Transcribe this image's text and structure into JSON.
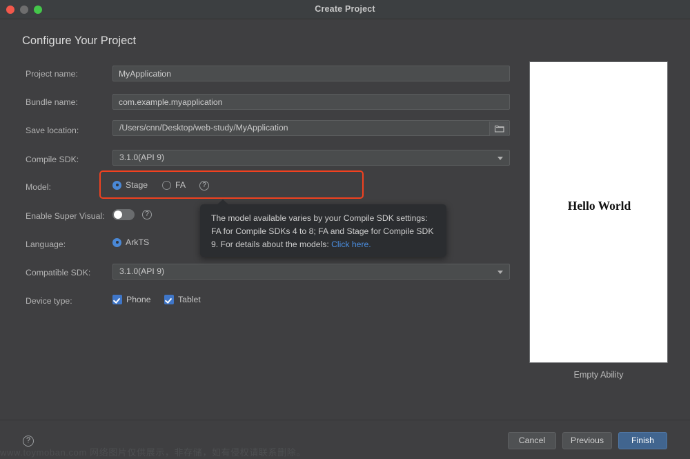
{
  "window": {
    "title": "Create Project",
    "traffic_lights": [
      "close-button",
      "minimize-button",
      "maximize-button"
    ]
  },
  "page_title": "Configure Your Project",
  "form": {
    "project_name": {
      "label": "Project name:",
      "value": "MyApplication",
      "placeholder": "Project name"
    },
    "bundle_name": {
      "label": "Bundle name:",
      "value": "com.example.myapplication",
      "placeholder": "Bundle name"
    },
    "save_location": {
      "label": "Save location:",
      "value": "/Users/cnn/Desktop/web-study/MyApplication",
      "placeholder": "Save location",
      "browse_icon": "folder-icon"
    },
    "compile_sdk": {
      "label": "Compile SDK:",
      "value": "3.1.0(API 9)",
      "options": [
        "3.1.0(API 9)"
      ],
      "arrow_icon": "chevron-down-icon"
    },
    "model": {
      "label": "Model:",
      "options": [
        {
          "label": "Stage",
          "selected": true
        },
        {
          "label": "FA",
          "selected": false
        }
      ],
      "help_icon": "question-mark-icon",
      "help_glyph": "?"
    },
    "enable_super_visual": {
      "label": "Enable Super Visual:",
      "state": "off",
      "help_icon": "question-mark-icon",
      "help_glyph": "?"
    },
    "language": {
      "label": "Language:",
      "options": [
        {
          "label": "ArkTS",
          "selected": true
        }
      ]
    },
    "compatible_sdk": {
      "label": "Compatible SDK:",
      "value": "3.1.0(API 9)",
      "options": [
        "3.1.0(API 9)"
      ],
      "arrow_icon": "chevron-down-icon"
    },
    "device_type": {
      "label": "Device type:",
      "options": [
        {
          "label": "Phone",
          "checked": true
        },
        {
          "label": "Tablet",
          "checked": true
        }
      ]
    }
  },
  "tooltip": {
    "line1": "The model available varies by your Compile SDK settings:",
    "line2": "FA for Compile SDKs 4 to 8; FA and Stage for Compile SDK",
    "line3_prefix": "9. For details about the models: ",
    "link_text": "Click here."
  },
  "preview": {
    "text": "Hello World",
    "caption": "Empty Ability"
  },
  "footer": {
    "help_icon": "question-mark-icon",
    "help_glyph": "?",
    "cancel": "Cancel",
    "previous": "Previous",
    "finish": "Finish"
  },
  "watermark": "www.toymoban.com 网络图片仅供展示，非存储，如有侵权请联系删除。",
  "colors": {
    "dialog_bg": "#3f3f41",
    "titlebar_bg": "#3c3f41",
    "field_bg": "#4b4d4e",
    "accent_blue": "#4a88d6",
    "primary_button": "#41658f",
    "highlight_red": "#f2411f",
    "tooltip_bg": "#2b2d30",
    "link_blue": "#4b8ee0"
  }
}
